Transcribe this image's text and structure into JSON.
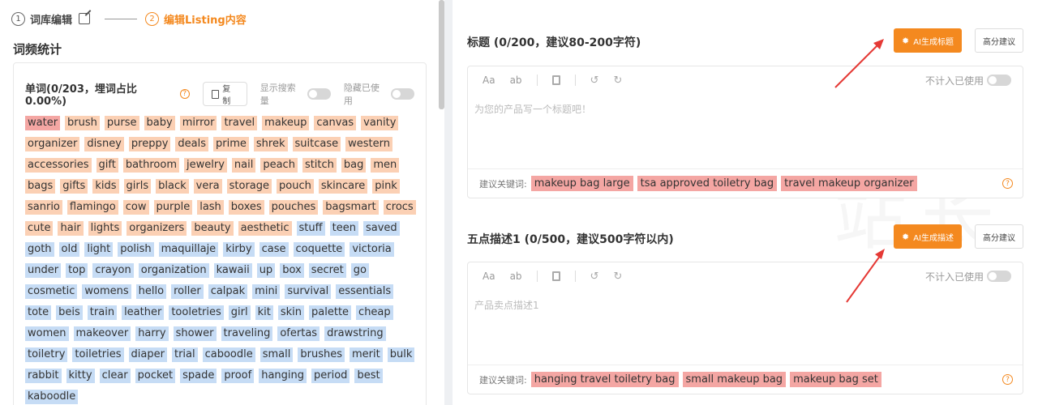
{
  "steps": [
    {
      "num": "1",
      "label": "词库编辑"
    },
    {
      "num": "2",
      "label": "编辑Listing内容"
    }
  ],
  "left": {
    "section_title": "词频统计",
    "word_title": "单词(0/203，埋词占比0.00%)",
    "copy_label": "复制",
    "toggle_show_search": "显示搜索量",
    "toggle_hide_used": "隐藏已使用",
    "tags": [
      {
        "text": "water",
        "color": "red"
      },
      {
        "text": "brush",
        "color": "orange"
      },
      {
        "text": "purse",
        "color": "orange"
      },
      {
        "text": "baby",
        "color": "orange"
      },
      {
        "text": "mirror",
        "color": "orange"
      },
      {
        "text": "travel",
        "color": "orange"
      },
      {
        "text": "makeup",
        "color": "orange"
      },
      {
        "text": "canvas",
        "color": "orange"
      },
      {
        "text": "vanity",
        "color": "orange"
      },
      {
        "text": "organizer",
        "color": "orange"
      },
      {
        "text": "disney",
        "color": "orange"
      },
      {
        "text": "preppy",
        "color": "orange"
      },
      {
        "text": "deals",
        "color": "orange"
      },
      {
        "text": "prime",
        "color": "orange"
      },
      {
        "text": "shrek",
        "color": "orange"
      },
      {
        "text": "suitcase",
        "color": "orange"
      },
      {
        "text": "western",
        "color": "orange"
      },
      {
        "text": "accessories",
        "color": "orange"
      },
      {
        "text": "gift",
        "color": "orange"
      },
      {
        "text": "bathroom",
        "color": "orange"
      },
      {
        "text": "jewelry",
        "color": "orange"
      },
      {
        "text": "nail",
        "color": "orange"
      },
      {
        "text": "peach",
        "color": "orange"
      },
      {
        "text": "stitch",
        "color": "orange"
      },
      {
        "text": "bag",
        "color": "orange"
      },
      {
        "text": "men",
        "color": "orange"
      },
      {
        "text": "bags",
        "color": "orange"
      },
      {
        "text": "gifts",
        "color": "orange"
      },
      {
        "text": "kids",
        "color": "orange"
      },
      {
        "text": "girls",
        "color": "orange"
      },
      {
        "text": "black",
        "color": "orange"
      },
      {
        "text": "vera",
        "color": "orange"
      },
      {
        "text": "storage",
        "color": "orange"
      },
      {
        "text": "pouch",
        "color": "orange"
      },
      {
        "text": "skincare",
        "color": "orange"
      },
      {
        "text": "pink",
        "color": "orange"
      },
      {
        "text": "sanrio",
        "color": "orange"
      },
      {
        "text": "flamingo",
        "color": "orange"
      },
      {
        "text": "cow",
        "color": "orange"
      },
      {
        "text": "purple",
        "color": "orange"
      },
      {
        "text": "lash",
        "color": "orange"
      },
      {
        "text": "boxes",
        "color": "orange"
      },
      {
        "text": "pouches",
        "color": "orange"
      },
      {
        "text": "bagsmart",
        "color": "orange"
      },
      {
        "text": "crocs",
        "color": "orange"
      },
      {
        "text": "cute",
        "color": "orange"
      },
      {
        "text": "hair",
        "color": "orange"
      },
      {
        "text": "lights",
        "color": "orange"
      },
      {
        "text": "organizers",
        "color": "orange"
      },
      {
        "text": "beauty",
        "color": "orange"
      },
      {
        "text": "aesthetic",
        "color": "orange"
      },
      {
        "text": "stuff",
        "color": "blue"
      },
      {
        "text": "teen",
        "color": "blue"
      },
      {
        "text": "saved",
        "color": "blue"
      },
      {
        "text": "goth",
        "color": "blue"
      },
      {
        "text": "old",
        "color": "blue"
      },
      {
        "text": "light",
        "color": "blue"
      },
      {
        "text": "polish",
        "color": "blue"
      },
      {
        "text": "maquillaje",
        "color": "blue"
      },
      {
        "text": "kirby",
        "color": "blue"
      },
      {
        "text": "case",
        "color": "blue"
      },
      {
        "text": "coquette",
        "color": "blue"
      },
      {
        "text": "victoria",
        "color": "blue"
      },
      {
        "text": "under",
        "color": "blue"
      },
      {
        "text": "top",
        "color": "blue"
      },
      {
        "text": "crayon",
        "color": "blue"
      },
      {
        "text": "organization",
        "color": "blue"
      },
      {
        "text": "kawaii",
        "color": "blue"
      },
      {
        "text": "up",
        "color": "blue"
      },
      {
        "text": "box",
        "color": "blue"
      },
      {
        "text": "secret",
        "color": "blue"
      },
      {
        "text": "go",
        "color": "blue"
      },
      {
        "text": "cosmetic",
        "color": "blue"
      },
      {
        "text": "womens",
        "color": "blue"
      },
      {
        "text": "hello",
        "color": "blue"
      },
      {
        "text": "roller",
        "color": "blue"
      },
      {
        "text": "calpak",
        "color": "blue"
      },
      {
        "text": "mini",
        "color": "blue"
      },
      {
        "text": "survival",
        "color": "blue"
      },
      {
        "text": "essentials",
        "color": "blue"
      },
      {
        "text": "tote",
        "color": "blue"
      },
      {
        "text": "beis",
        "color": "blue"
      },
      {
        "text": "train",
        "color": "blue"
      },
      {
        "text": "leather",
        "color": "blue"
      },
      {
        "text": "tooletries",
        "color": "blue"
      },
      {
        "text": "girl",
        "color": "blue"
      },
      {
        "text": "kit",
        "color": "blue"
      },
      {
        "text": "skin",
        "color": "blue"
      },
      {
        "text": "palette",
        "color": "blue"
      },
      {
        "text": "cheap",
        "color": "blue"
      },
      {
        "text": "women",
        "color": "blue"
      },
      {
        "text": "makeover",
        "color": "blue"
      },
      {
        "text": "harry",
        "color": "blue"
      },
      {
        "text": "shower",
        "color": "blue"
      },
      {
        "text": "traveling",
        "color": "blue"
      },
      {
        "text": "ofertas",
        "color": "blue"
      },
      {
        "text": "drawstring",
        "color": "blue"
      },
      {
        "text": "toiletry",
        "color": "blue"
      },
      {
        "text": "toiletries",
        "color": "blue"
      },
      {
        "text": "diaper",
        "color": "blue"
      },
      {
        "text": "trial",
        "color": "blue"
      },
      {
        "text": "caboodle",
        "color": "blue"
      },
      {
        "text": "small",
        "color": "blue"
      },
      {
        "text": "brushes",
        "color": "blue"
      },
      {
        "text": "merit",
        "color": "blue"
      },
      {
        "text": "bulk",
        "color": "blue"
      },
      {
        "text": "rabbit",
        "color": "blue"
      },
      {
        "text": "kitty",
        "color": "blue"
      },
      {
        "text": "clear",
        "color": "blue"
      },
      {
        "text": "pocket",
        "color": "blue"
      },
      {
        "text": "spade",
        "color": "blue"
      },
      {
        "text": "proof",
        "color": "blue"
      },
      {
        "text": "hanging",
        "color": "blue"
      },
      {
        "text": "period",
        "color": "blue"
      },
      {
        "text": "best",
        "color": "blue"
      },
      {
        "text": "kaboodle",
        "color": "blue"
      }
    ]
  },
  "title_block": {
    "title": "标题 (0/200，建议80-200字符)",
    "ai_label": "AI生成标题",
    "hi_label": "高分建议",
    "toolbar": {
      "aa": "Aa",
      "ab": "ab"
    },
    "not_count_label": "不计入已使用",
    "placeholder": "为您的产品写一个标题吧！",
    "kw_label": "建议关键词:",
    "keywords": [
      "makeup bag large",
      "tsa approved toiletry bag",
      "travel makeup organizer"
    ]
  },
  "bullet_block": {
    "title": "五点描述1 (0/500，建议500字符以内)",
    "ai_label": "AI生成描述",
    "hi_label": "高分建议",
    "toolbar": {
      "aa": "Aa",
      "ab": "ab"
    },
    "not_count_label": "不计入已使用",
    "placeholder": "产品卖点描述1",
    "kw_label": "建议关键词:",
    "keywords": [
      "hanging travel toiletry bag",
      "small makeup bag",
      "makeup bag set"
    ]
  },
  "colors": {
    "accent": "#f4891f",
    "tag_red": "#f4a6a3",
    "tag_orange": "#fbd0b4",
    "tag_blue": "#c6dcf5"
  }
}
